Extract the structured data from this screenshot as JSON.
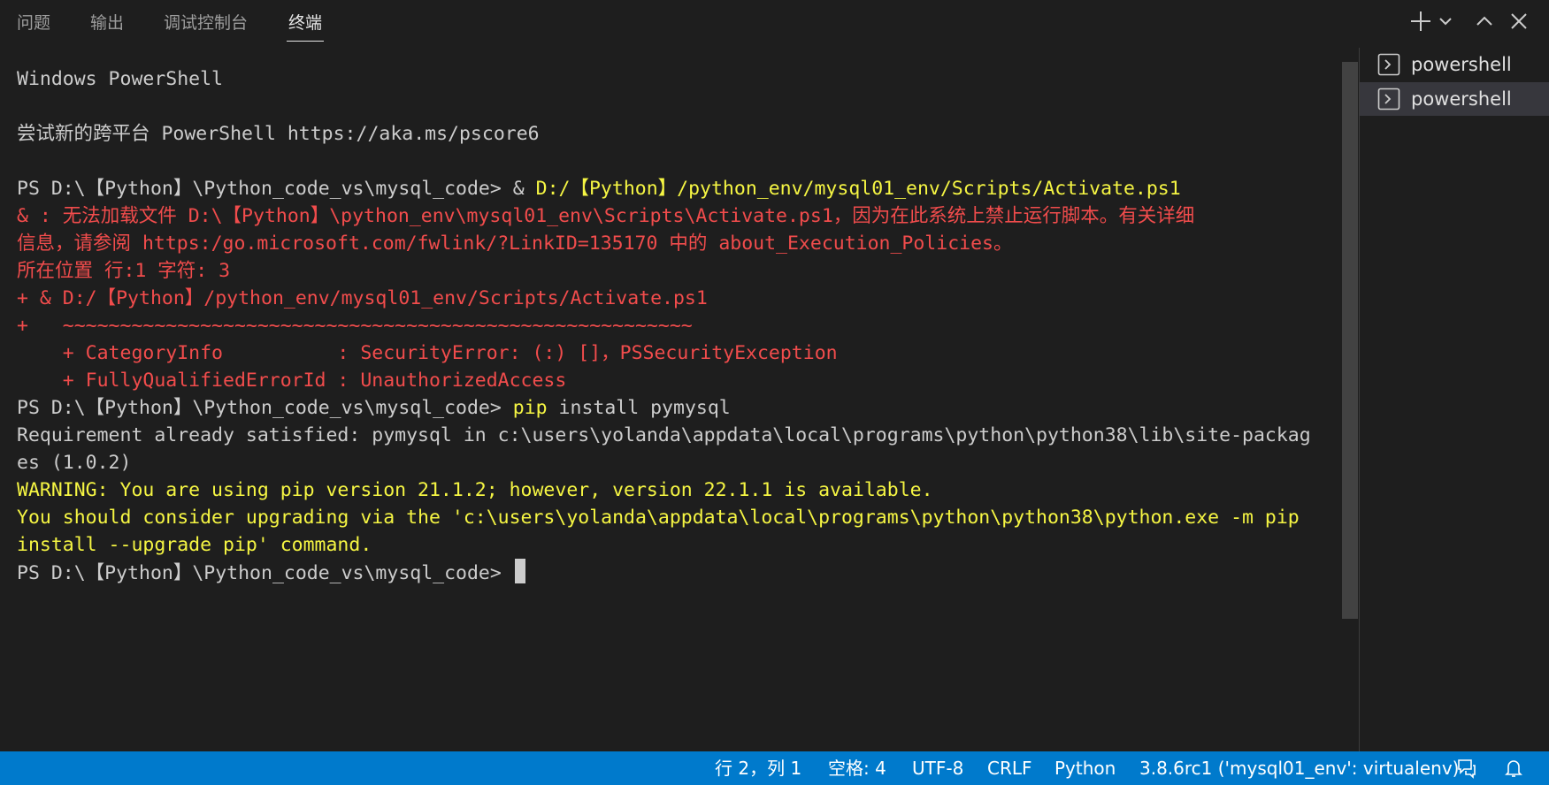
{
  "panel": {
    "tabs": [
      {
        "label": "问题",
        "active": false
      },
      {
        "label": "输出",
        "active": false
      },
      {
        "label": "调试控制台",
        "active": false
      },
      {
        "label": "终端",
        "active": true
      }
    ],
    "icons": [
      "plus-icon",
      "chevron-down-icon",
      "chevron-up-icon",
      "close-icon"
    ]
  },
  "terminal": {
    "lines": [
      {
        "segments": [
          {
            "text": "Windows PowerShell",
            "color": "default"
          }
        ]
      },
      {
        "segments": []
      },
      {
        "segments": [
          {
            "text": "尝试新的跨平台 PowerShell https://aka.ms/pscore6",
            "color": "default"
          }
        ]
      },
      {
        "segments": []
      },
      {
        "segments": [
          {
            "text": "PS D:\\【Python】\\Python_code_vs\\mysql_code> & ",
            "color": "default"
          },
          {
            "text": "D:/【Python】/python_env/mysql01_env/Scripts/Activate.ps1",
            "color": "yellow"
          }
        ]
      },
      {
        "segments": [
          {
            "text": "& : 无法加载文件 D:\\【Python】\\python_env\\mysql01_env\\Scripts\\Activate.ps1，因为在此系统上禁止运行脚本。有关详细",
            "color": "red"
          }
        ]
      },
      {
        "segments": [
          {
            "text": "信息，请参阅 https:/go.microsoft.com/fwlink/?LinkID=135170 中的 about_Execution_Policies。",
            "color": "red"
          }
        ]
      },
      {
        "segments": [
          {
            "text": "所在位置 行:1 字符: 3",
            "color": "red"
          }
        ]
      },
      {
        "segments": [
          {
            "text": "+ & D:/【Python】/python_env/mysql01_env/Scripts/Activate.ps1",
            "color": "red"
          }
        ]
      },
      {
        "segments": [
          {
            "text": "+   ~~~~~~~~~~~~~~~~~~~~~~~~~~~~~~~~~~~~~~~~~~~~~~~~~~~~~~~",
            "color": "red"
          }
        ]
      },
      {
        "segments": [
          {
            "text": "    + CategoryInfo          : SecurityError: (:) []，PSSecurityException",
            "color": "red"
          }
        ]
      },
      {
        "segments": [
          {
            "text": "    + FullyQualifiedErrorId : UnauthorizedAccess",
            "color": "red"
          }
        ]
      },
      {
        "segments": [
          {
            "text": "PS D:\\【Python】\\Python_code_vs\\mysql_code> ",
            "color": "default"
          },
          {
            "text": "pip",
            "color": "yellow"
          },
          {
            "text": " install pymysql",
            "color": "default"
          }
        ]
      },
      {
        "segments": [
          {
            "text": "Requirement already satisfied: pymysql in c:\\users\\yolanda\\appdata\\local\\programs\\python\\python38\\lib\\site-packag",
            "color": "default"
          }
        ]
      },
      {
        "segments": [
          {
            "text": "es (1.0.2)",
            "color": "default"
          }
        ]
      },
      {
        "segments": [
          {
            "text": "WARNING: You are using pip version 21.1.2; however, version 22.1.1 is available.",
            "color": "yellow"
          }
        ]
      },
      {
        "segments": [
          {
            "text": "You should consider upgrading via the 'c:\\users\\yolanda\\appdata\\local\\programs\\python\\python38\\python.exe -m pip",
            "color": "yellow"
          }
        ]
      },
      {
        "segments": [
          {
            "text": "install --upgrade pip' command.",
            "color": "yellow"
          }
        ]
      },
      {
        "segments": [
          {
            "text": "PS D:\\【Python】\\Python_code_vs\\mysql_code> ",
            "color": "default"
          }
        ],
        "cursor": true
      }
    ]
  },
  "terminal_list": [
    {
      "label": "powershell",
      "selected": false
    },
    {
      "label": "powershell",
      "selected": true
    }
  ],
  "statusbar": {
    "position": "行 2，列 1",
    "indent": "空格: 4",
    "encoding": "UTF-8",
    "eol": "CRLF",
    "language": "Python",
    "interpreter": "3.8.6rc1 ('mysql01_env': virtualenv)",
    "icons": [
      "feedback-icon",
      "bell-icon"
    ]
  },
  "colors": {
    "default": "#cccccc",
    "yellow": "#f5f543",
    "red": "#f14c4c",
    "statusbar": "#007acc",
    "background": "#1e1e1e"
  }
}
